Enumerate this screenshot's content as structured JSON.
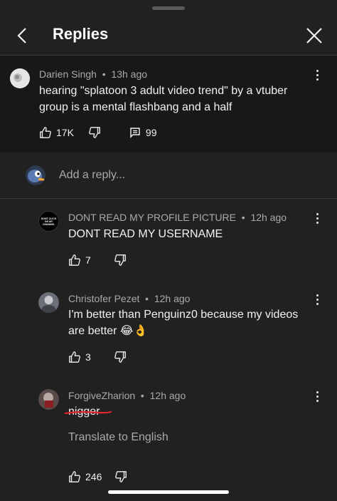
{
  "header": {
    "title": "Replies"
  },
  "parent": {
    "author": "Darien Singh",
    "time": "13h ago",
    "text": "hearing \"splatoon 3 adult video trend\" by a vtuber group is a mental flashbang and a half",
    "likes": "17K",
    "replies": "99"
  },
  "reply_box": {
    "placeholder": "Add a reply..."
  },
  "replies": [
    {
      "author": "DONT READ MY PROFILE PICTURE",
      "time": "12h ago",
      "text": "DONT READ MY USERNAME",
      "likes": "7",
      "avatar_text": "DONT CLICK ON MY CHANNEL"
    },
    {
      "author": "Christofer Pezet",
      "time": "12h ago",
      "text": "I'm better than Penguinz0 because my videos are better 😂👌",
      "likes": "3"
    },
    {
      "author": "ForgiveZharion",
      "time": "12h ago",
      "text": "nigger",
      "likes": "246",
      "translate_label": "Translate to English"
    }
  ],
  "colors": {
    "background": "#212121",
    "parent_bg": "#181818",
    "meta": "#aaaaaa",
    "strike": "#e0242a"
  }
}
